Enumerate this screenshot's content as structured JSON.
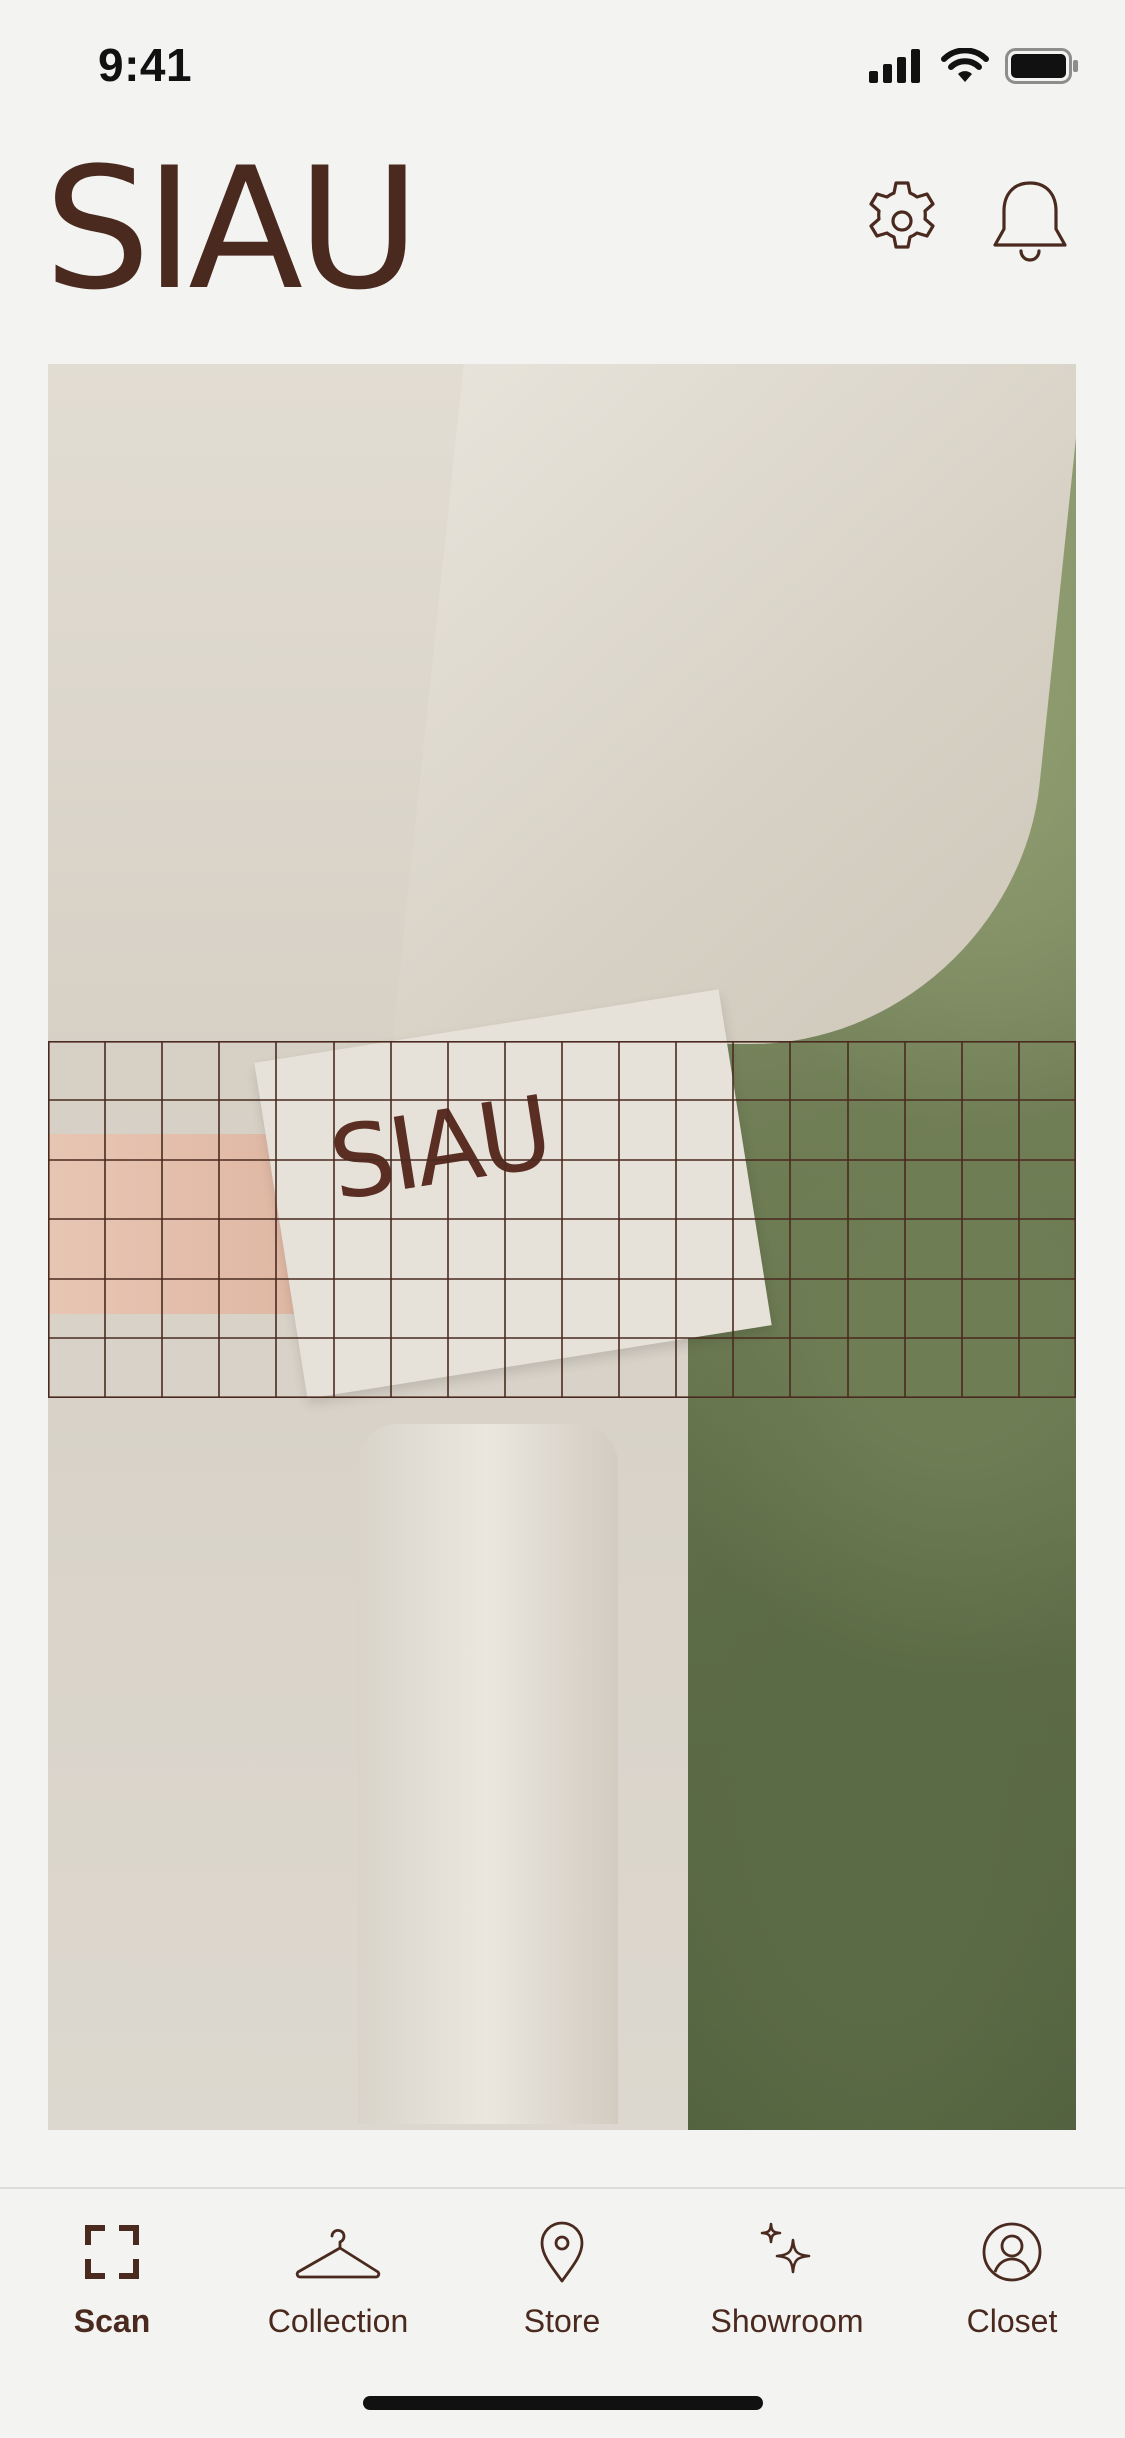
{
  "status_bar": {
    "time": "9:41"
  },
  "header": {
    "brand": "SIAU",
    "settings_icon": "gear-icon",
    "notifications_icon": "bell-icon"
  },
  "photo": {
    "tag_text": "SIAU"
  },
  "tabs": [
    {
      "label": "Scan",
      "icon": "scan-frame-icon",
      "active": true
    },
    {
      "label": "Collection",
      "icon": "hanger-icon",
      "active": false
    },
    {
      "label": "Store",
      "icon": "map-pin-icon",
      "active": false
    },
    {
      "label": "Showroom",
      "icon": "sparkles-icon",
      "active": false
    },
    {
      "label": "Closet",
      "icon": "user-circle-icon",
      "active": false
    }
  ],
  "colors": {
    "brand": "#4a2a1f",
    "background": "#f3f3f1"
  }
}
